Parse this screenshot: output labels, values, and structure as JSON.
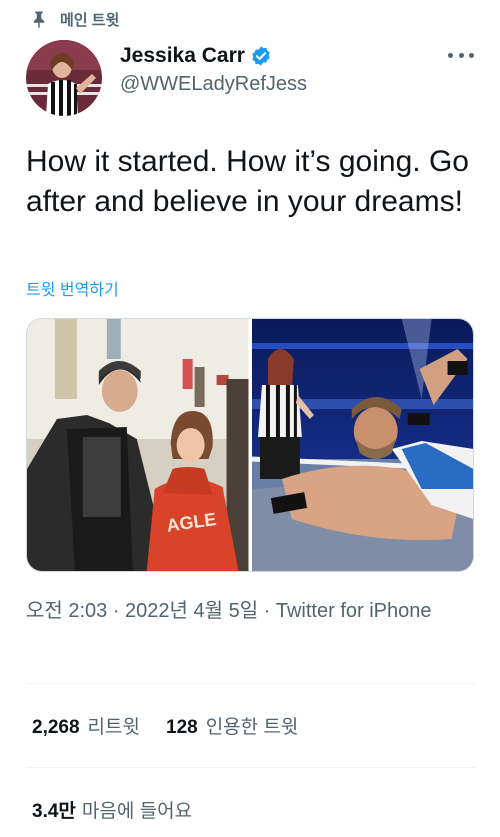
{
  "pinned_label": "메인 트윗",
  "author": {
    "display_name": "Jessika Carr",
    "handle": "@WWELadyRefJess",
    "verified": true
  },
  "tweet": {
    "text": "How it started. How it’s going. Go after and believe in your dreams!",
    "translate_label": "트윗 번역하기",
    "timestamp": "오전 2:03 · 2022년 4월 5일 · Twitter for iPhone"
  },
  "stats": {
    "retweets_count": "2,268",
    "retweets_label": "리트윗",
    "quotes_count": "128",
    "quotes_label": "인용한 트윗",
    "likes_count": "3.4만",
    "likes_label": "마음에 들어요"
  },
  "colors": {
    "accent": "#1d9bf0",
    "secondary_text": "#536471",
    "divider": "#eff3f4"
  },
  "icons": [
    "pin-icon",
    "verified-badge-icon",
    "more-options-icon"
  ]
}
